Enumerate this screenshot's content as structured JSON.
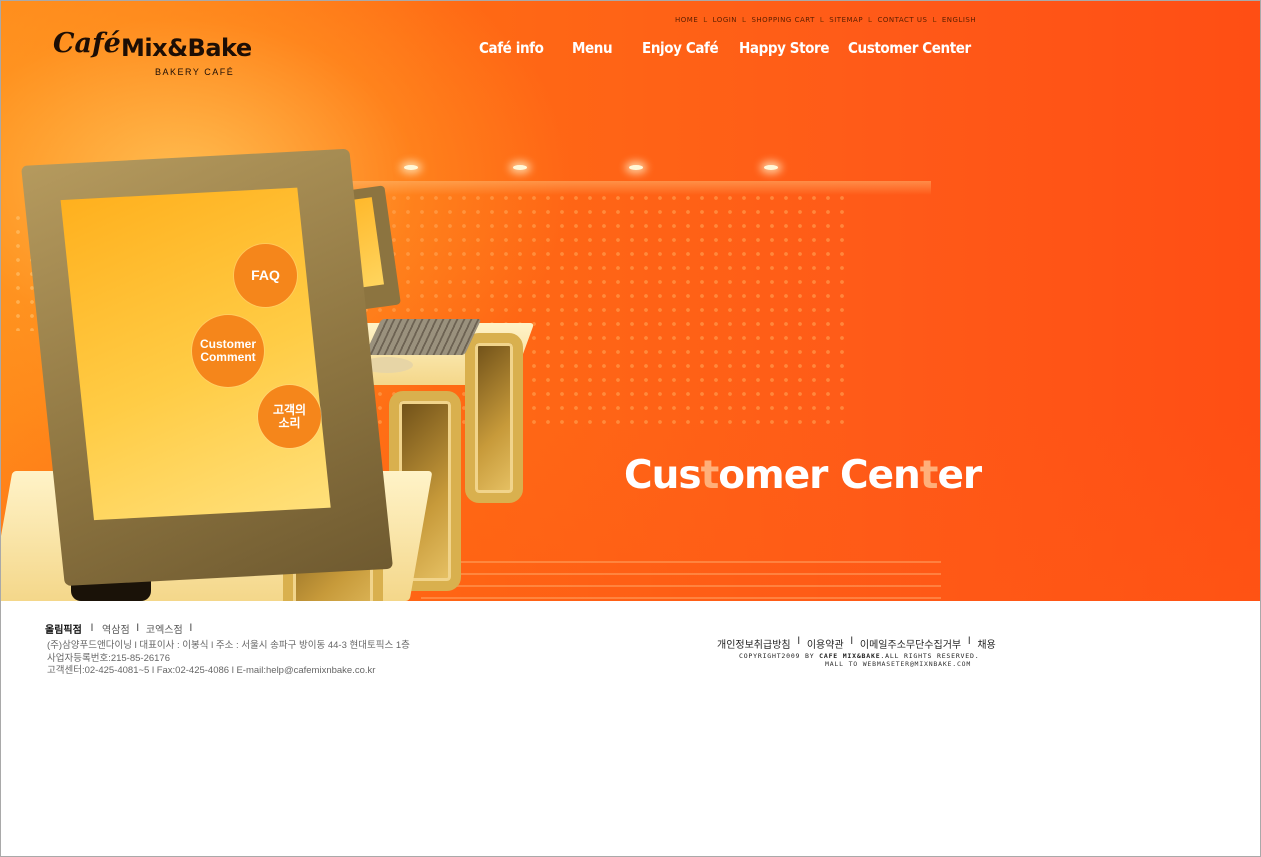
{
  "util_links": [
    "HOME",
    "LOGIN",
    "SHOPPING CART",
    "SITEMAP",
    "CONTACT US",
    "ENGLISH"
  ],
  "logo": {
    "cafe": "Café",
    "brand": "Mix&Bake",
    "sub": "BAKERY CAFÉ"
  },
  "gnb": [
    "Café info",
    "Menu",
    "Enjoy Café",
    "Happy Store",
    "Customer Center"
  ],
  "circles": {
    "faq": "FAQ",
    "comment": "Customer\nComment",
    "voice": "고객의\n소리"
  },
  "hero": {
    "title_part1": "Cus",
    "title_t1": "t",
    "title_part2": "omer Cen",
    "title_t2": "t",
    "title_part3": "er"
  },
  "footer": {
    "stores": [
      "올림픽점",
      "역삼점",
      "코엑스점"
    ],
    "info_lines": [
      "(주)삼양푸드앤다이닝 l 대표이사 : 이봉식 l 주소 : 서울시 송파구 방이동 44-3 현대토픽스 1층",
      "사업자등록번호:215-85-26176",
      "고객센터:02-425-4081~5 l Fax:02-425-4086 l E-mail:help@cafemixnbake.co.kr"
    ],
    "policy": [
      "개인정보취급방침",
      "이용약관",
      "이메일주소무단수집거부",
      "채용"
    ],
    "copyright_a": "COPYRIGHT2009 BY ",
    "copyright_b": "CAFE MIX&BAKE",
    "copyright_c": ".ALL RIGHTS RESERVED.",
    "mailto": "MALL TO WEBMASETER@MIXNBAKE.COM"
  },
  "colors": {
    "accent": "#ff5a18",
    "circle": "#f5861b",
    "screen": "#ffb01e"
  }
}
